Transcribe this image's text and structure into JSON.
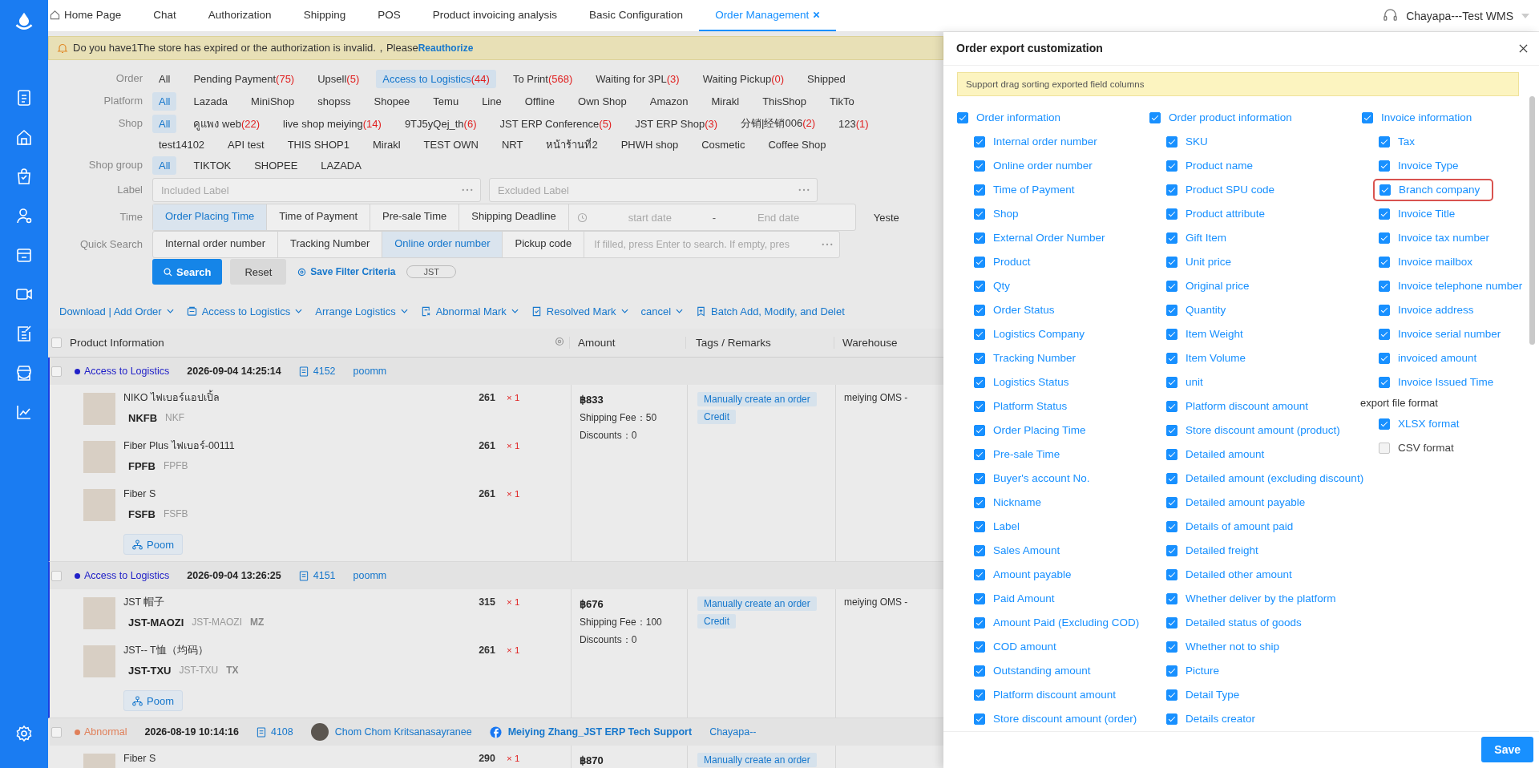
{
  "tabs": [
    {
      "label": "Home Page",
      "kind": "home",
      "selected": false,
      "closable": false
    },
    {
      "label": "Chat",
      "kind": "plain",
      "selected": false,
      "closable": false
    },
    {
      "label": "Authorization",
      "kind": "plain",
      "selected": false,
      "closable": false
    },
    {
      "label": "Shipping",
      "kind": "plain",
      "selected": false,
      "closable": false
    },
    {
      "label": "POS",
      "kind": "plain",
      "selected": false,
      "closable": false
    },
    {
      "label": "Product invoicing analysis",
      "kind": "plain",
      "selected": false,
      "closable": false
    },
    {
      "label": "Basic Configuration",
      "kind": "plain",
      "selected": false,
      "closable": false
    },
    {
      "label": "Order Management",
      "kind": "plain",
      "selected": true,
      "closable": true
    }
  ],
  "user": {
    "name": "Chayapa---Test WMS"
  },
  "notice": {
    "text": "Do you have1The store has expired or the authorization is invalid.，Please",
    "link": "Reauthorize"
  },
  "filters": {
    "options": [
      {
        "label": "Order",
        "lines": [
          [
            {
              "text": "All",
              "selected": false
            },
            {
              "text": "Pending Payment",
              "count": "(75)",
              "selected": false
            },
            {
              "text": "Upsell",
              "count": "(5)",
              "selected": false
            },
            {
              "text": "Access to Logistics",
              "count": "(44)",
              "selected": true
            },
            {
              "text": "To Print",
              "count": "(568)",
              "selected": false
            },
            {
              "text": "Waiting for 3PL",
              "count": "(3)",
              "selected": false
            },
            {
              "text": "Waiting Pickup",
              "count": "(0)",
              "selected": false
            },
            {
              "text": "Shipped",
              "selected": false
            }
          ]
        ]
      },
      {
        "label": "Platform",
        "lines": [
          [
            {
              "text": "All",
              "selected": true
            },
            {
              "text": "Lazada",
              "selected": false
            },
            {
              "text": "MiniShop",
              "selected": false
            },
            {
              "text": "shopss",
              "selected": false
            },
            {
              "text": "Shopee",
              "selected": false
            },
            {
              "text": "Temu",
              "selected": false
            },
            {
              "text": "Line",
              "selected": false
            },
            {
              "text": "Offline",
              "selected": false
            },
            {
              "text": "Own Shop",
              "selected": false
            },
            {
              "text": "Amazon",
              "selected": false
            },
            {
              "text": "Mirakl",
              "selected": false
            },
            {
              "text": "ThisShop",
              "selected": false
            },
            {
              "text": "TikTo",
              "selected": false
            }
          ]
        ]
      },
      {
        "label": "Shop",
        "lines": [
          [
            {
              "text": "All",
              "selected": true
            },
            {
              "text": "คูแพง web",
              "count": "(22)",
              "selected": false
            },
            {
              "text": "live shop meiying",
              "count": "(14)",
              "selected": false
            },
            {
              "text": "9TJ5yQej_th",
              "count": "(6)",
              "selected": false
            },
            {
              "text": "JST ERP Conference",
              "count": "(5)",
              "selected": false
            },
            {
              "text": "JST ERP Shop",
              "count": "(3)",
              "selected": false
            },
            {
              "text": "分销|经销006",
              "count": "(2)",
              "selected": false
            },
            {
              "text": "123",
              "count": "(1)",
              "selected": false
            }
          ],
          [
            {
              "text": "test14102",
              "selected": false
            },
            {
              "text": "API test",
              "selected": false
            },
            {
              "text": "THIS SHOP1",
              "selected": false
            },
            {
              "text": "Mirakl",
              "selected": false
            },
            {
              "text": "TEST OWN",
              "selected": false
            },
            {
              "text": "NRT",
              "selected": false
            },
            {
              "text": "หน้าร้านที่2",
              "selected": false
            },
            {
              "text": "PHWH shop",
              "selected": false
            },
            {
              "text": "Cosmetic",
              "selected": false
            },
            {
              "text": "Coffee Shop",
              "selected": false
            }
          ]
        ]
      },
      {
        "label": "Shop group",
        "lines": [
          [
            {
              "text": "All",
              "selected": true
            },
            {
              "text": "TIKTOK",
              "selected": false
            },
            {
              "text": "SHOPEE",
              "selected": false
            },
            {
              "text": "LAZADA",
              "selected": false
            }
          ]
        ]
      }
    ],
    "label_filter": {
      "label": "Label",
      "fields": [
        {
          "placeholder": "Included Label"
        },
        {
          "placeholder": "Excluded Label"
        }
      ]
    },
    "time": {
      "label": "Time",
      "segments": [
        {
          "text": "Order Placing Time",
          "selected": true
        },
        {
          "text": "Time of Payment",
          "selected": false
        },
        {
          "text": "Pre-sale Time",
          "selected": false
        },
        {
          "text": "Shipping Deadline",
          "selected": false
        }
      ],
      "start_placeholder": "start date",
      "separator": "-",
      "end_placeholder": "End date",
      "shortcut": "Yeste"
    },
    "quick_search": {
      "label": "Quick Search",
      "segments": [
        {
          "text": "Internal order number",
          "selected": false
        },
        {
          "text": "Tracking Number",
          "selected": false
        },
        {
          "text": "Online order number",
          "selected": true
        },
        {
          "text": "Pickup code",
          "selected": false
        }
      ],
      "placeholder": "If filled, press Enter to search. If empty, pres"
    },
    "actions": {
      "search": "Search",
      "reset": "Reset",
      "save": "Save Filter Criteria",
      "tag": "JST"
    }
  },
  "toolbar": [
    {
      "text": "Download | Add Order",
      "kind": "plain",
      "caret": true
    },
    {
      "text": "Access to Logistics",
      "kind": "box",
      "caret": true
    },
    {
      "text": "Arrange Logistics",
      "kind": "plain",
      "caret": true
    },
    {
      "text": "Abnormal Mark",
      "kind": "abnormal",
      "caret": true
    },
    {
      "text": "Resolved Mark",
      "kind": "resolved",
      "caret": true
    },
    {
      "text": "cancel",
      "kind": "plain",
      "caret": true
    },
    {
      "text": "Batch Add, Modify, and Delet",
      "kind": "bookmark",
      "caret": false
    }
  ],
  "table": {
    "select_all_checked": false,
    "columns": [
      "Product Information",
      "Amount",
      "Tags / Remarks",
      "Warehouse"
    ],
    "orders": [
      {
        "selected": true,
        "checked": false,
        "status": "Access to Logistics",
        "color": "#2020c8",
        "time": "2026-09-04 14:25:14",
        "doc_number": "4152",
        "extras": [
          {
            "kind": "text",
            "text": "poomm"
          }
        ],
        "items": [
          {
            "name": "NIKO ไฟเบอร์แอปเปิ้ล",
            "price": "261",
            "qty": "× 1",
            "code": "NKFB",
            "sku": "NKF"
          },
          {
            "name": "Fiber Plus ไฟเบอร์-00111",
            "price": "261",
            "qty": "× 1",
            "code": "FPFB",
            "sku": "FPFB"
          },
          {
            "name": "Fiber S",
            "price": "261",
            "qty": "× 1",
            "code": "FSFB",
            "sku": "FSFB"
          }
        ],
        "assignee": "Poom",
        "amount": "฿833",
        "fees": [
          {
            "label": "Shipping Fee：",
            "value": "50"
          },
          {
            "label": "Discounts：",
            "value": "0"
          }
        ],
        "tags": [
          "Manually create an order",
          "Credit"
        ],
        "warehouse": "meiying OMS -"
      },
      {
        "selected": true,
        "checked": false,
        "status": "Access to Logistics",
        "color": "#2020c8",
        "time": "2026-09-04 13:26:25",
        "doc_number": "4151",
        "extras": [
          {
            "kind": "text",
            "text": "poomm"
          }
        ],
        "items": [
          {
            "name": "JST 帽子",
            "price": "315",
            "qty": "× 1",
            "code": "JST-MAOZI",
            "sku": "JST-MAOZI",
            "short": "MZ"
          },
          {
            "name": "JST-- T恤（均码）",
            "price": "261",
            "qty": "× 1",
            "code": "JST-TXU",
            "sku": "JST-TXU",
            "short": "TX"
          }
        ],
        "assignee": "Poom",
        "amount": "฿676",
        "fees": [
          {
            "label": "Shipping Fee：",
            "value": "100"
          },
          {
            "label": "Discounts：",
            "value": "0"
          }
        ],
        "tags": [
          "Manually create an order",
          "Credit"
        ],
        "warehouse": "meiying OMS -"
      },
      {
        "selected": false,
        "checked": false,
        "status": "Abnormal",
        "color": "#e0805a",
        "time": "2026-08-19 10:14:16",
        "doc_number": "4108",
        "extras": [
          {
            "kind": "avatar",
            "text": "Chom Chom Kritsanasayranee"
          },
          {
            "kind": "social",
            "text": "Meiying Zhang_JST ERP Tech Support"
          },
          {
            "kind": "text",
            "text": "Chayapa--"
          }
        ],
        "items": [
          {
            "name": "Fiber S",
            "price": "290",
            "qty": "× 1"
          }
        ],
        "amount": "฿870",
        "tags": [
          "Manually create an order"
        ]
      }
    ]
  },
  "export": {
    "title": "Order export customization",
    "notice": "Support drag sorting exported field columns",
    "groups": [
      {
        "label": "Order information",
        "checked": true,
        "fields": [
          {
            "label": "Internal order number",
            "checked": true
          },
          {
            "label": "Online order number",
            "checked": true
          },
          {
            "label": "Time of Payment",
            "checked": true
          },
          {
            "label": "Shop",
            "checked": true
          },
          {
            "label": "External Order Number",
            "checked": true
          },
          {
            "label": "Product",
            "checked": true
          },
          {
            "label": "Qty",
            "checked": true
          },
          {
            "label": "Order Status",
            "checked": true
          },
          {
            "label": "Logistics Company",
            "checked": true
          },
          {
            "label": "Tracking Number",
            "checked": true
          },
          {
            "label": "Logistics Status",
            "checked": true
          },
          {
            "label": "Platform Status",
            "checked": true
          },
          {
            "label": "Order Placing Time",
            "checked": true
          },
          {
            "label": "Pre-sale Time",
            "checked": true
          },
          {
            "label": "Buyer's account No.",
            "checked": true
          },
          {
            "label": "Nickname",
            "checked": true
          },
          {
            "label": "Label",
            "checked": true
          },
          {
            "label": "Sales Amount",
            "checked": true
          },
          {
            "label": "Amount payable",
            "checked": true
          },
          {
            "label": "Paid Amount",
            "checked": true
          },
          {
            "label": "Amount Paid (Excluding COD)",
            "checked": true
          },
          {
            "label": "COD amount",
            "checked": true
          },
          {
            "label": "Outstanding amount",
            "checked": true
          },
          {
            "label": "Platform discount amount",
            "checked": true
          },
          {
            "label": "Store discount amount (order)",
            "checked": true
          }
        ]
      },
      {
        "label": "Order product information",
        "checked": true,
        "fields": [
          {
            "label": "SKU",
            "checked": true
          },
          {
            "label": "Product name",
            "checked": true
          },
          {
            "label": "Product SPU code",
            "checked": true
          },
          {
            "label": "Product attribute",
            "checked": true
          },
          {
            "label": "Gift Item",
            "checked": true
          },
          {
            "label": "Unit price",
            "checked": true
          },
          {
            "label": "Original price",
            "checked": true
          },
          {
            "label": "Quantity",
            "checked": true
          },
          {
            "label": "Item Weight",
            "checked": true
          },
          {
            "label": "Item Volume",
            "checked": true
          },
          {
            "label": "unit",
            "checked": true
          },
          {
            "label": "Platform discount amount",
            "checked": true
          },
          {
            "label": "Store discount amount (product)",
            "checked": true
          },
          {
            "label": "Detailed amount",
            "checked": true
          },
          {
            "label": "Detailed amount (excluding discount)",
            "checked": true
          },
          {
            "label": "Detailed amount payable",
            "checked": true
          },
          {
            "label": "Details of amount paid",
            "checked": true
          },
          {
            "label": "Detailed freight",
            "checked": true
          },
          {
            "label": "Detailed other amount",
            "checked": true
          },
          {
            "label": "Whether deliver by the platform",
            "checked": true
          },
          {
            "label": "Detailed status of goods",
            "checked": true
          },
          {
            "label": "Whether not to ship",
            "checked": true
          },
          {
            "label": "Picture",
            "checked": true
          },
          {
            "label": "Detail Type",
            "checked": true
          },
          {
            "label": "Details creator",
            "checked": true
          }
        ]
      },
      {
        "label": "Invoice information",
        "checked": true,
        "fields": [
          {
            "label": "Tax",
            "checked": true,
            "highlighted": false
          },
          {
            "label": "Invoice Type",
            "checked": true,
            "highlighted": false
          },
          {
            "label": "Branch company",
            "checked": true,
            "highlighted": true
          },
          {
            "label": "Invoice Title",
            "checked": true,
            "highlighted": false
          },
          {
            "label": "Invoice tax number",
            "checked": true,
            "highlighted": false
          },
          {
            "label": "Invoice mailbox",
            "checked": true,
            "highlighted": false
          },
          {
            "label": "Invoice telephone number",
            "checked": true,
            "highlighted": false
          },
          {
            "label": "Invoice address",
            "checked": true,
            "highlighted": false
          },
          {
            "label": "Invoice serial number",
            "checked": true,
            "highlighted": false
          },
          {
            "label": "invoiced amount",
            "checked": true,
            "highlighted": false
          },
          {
            "label": "Invoice Issued Time",
            "checked": true,
            "highlighted": false
          }
        ]
      }
    ],
    "format": {
      "label": "export file format",
      "options": [
        {
          "label": "XLSX format",
          "checked": true
        },
        {
          "label": "CSV format",
          "checked": false
        }
      ]
    },
    "save": "Save"
  }
}
